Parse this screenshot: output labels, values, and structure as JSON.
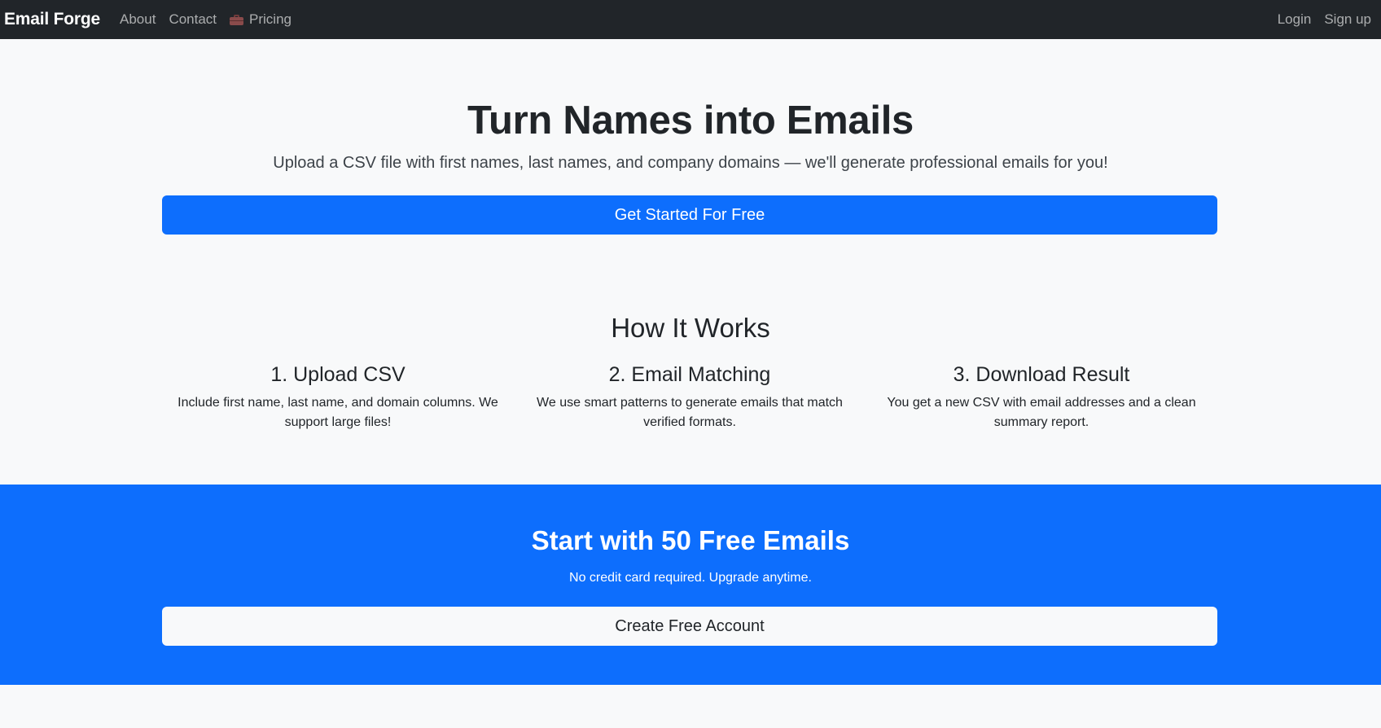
{
  "navbar": {
    "brand": "Email Forge",
    "links": [
      "About",
      "Contact",
      "Pricing"
    ],
    "pricing_icon": "briefcase-icon",
    "right_links": [
      "Login",
      "Sign up"
    ]
  },
  "hero": {
    "title": "Turn Names into Emails",
    "subtitle": "Upload a CSV file with first names, last names, and company domains — we'll generate professional emails for you!",
    "cta_label": "Get Started For Free"
  },
  "how_it_works": {
    "title": "How It Works",
    "steps": [
      {
        "title": "1. Upload CSV",
        "text": "Include first name, last name, and domain columns. We support large files!"
      },
      {
        "title": "2. Email Matching",
        "text": "We use smart patterns to generate emails that match verified formats."
      },
      {
        "title": "3. Download Result",
        "text": "You get a new CSV with email addresses and a clean summary report."
      }
    ]
  },
  "cta_section": {
    "title": "Start with 50 Free Emails",
    "subtitle": "No credit card required. Upgrade anytime.",
    "button_label": "Create Free Account"
  },
  "colors": {
    "navbar_bg": "#212529",
    "primary": "#0d6efd",
    "page_bg": "#f8f9fa"
  }
}
